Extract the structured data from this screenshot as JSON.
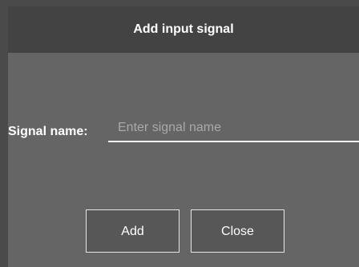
{
  "dialog": {
    "title": "Add input signal",
    "field": {
      "label": "Signal name:",
      "value": "",
      "placeholder": "Enter signal name"
    },
    "buttons": {
      "add_label": "Add",
      "close_label": "Close"
    }
  },
  "colors": {
    "titlebar": "#434343",
    "dialog_background": "#656565",
    "text": "#ffffff",
    "placeholder": "#a9a9a9"
  }
}
